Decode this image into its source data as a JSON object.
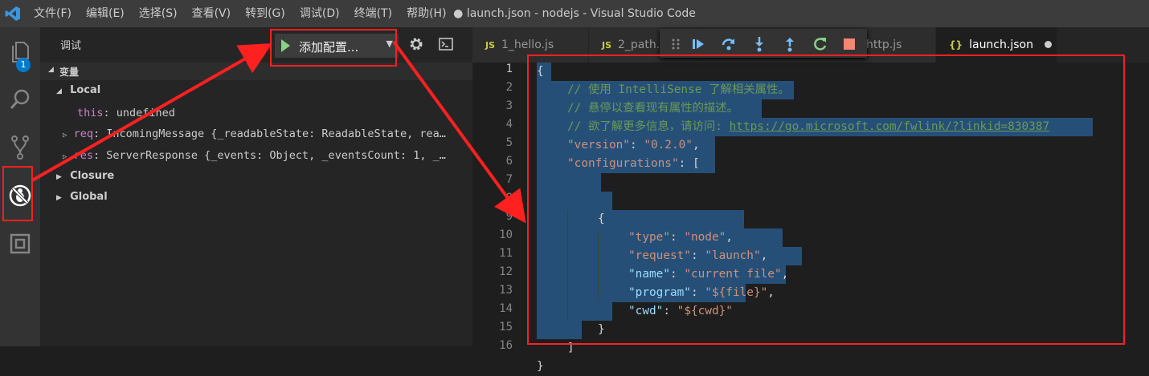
{
  "window": {
    "title": "● launch.json - nodejs - Visual Studio Code"
  },
  "menu": [
    "文件(F)",
    "编辑(E)",
    "选择(S)",
    "查看(V)",
    "转到(G)",
    "调试(D)",
    "终端(T)",
    "帮助(H)"
  ],
  "activity": {
    "badge": "1"
  },
  "sidebar": {
    "title": "调试",
    "config_label": "添加配置...",
    "sections": {
      "variables": "变量",
      "local": "Local",
      "closure": "Closure",
      "global": "Global"
    },
    "vars": {
      "this": {
        "name": "this",
        "value": "undefined"
      },
      "req": {
        "name": "req",
        "value": "IncomingMessage {_readableState: ReadableState, rea…"
      },
      "res": {
        "name": "res",
        "value": "ServerResponse {_events: Object, _eventsCount: 1, _…"
      }
    }
  },
  "tabs": [
    {
      "icon": "JS",
      "label": "1_hello.js"
    },
    {
      "icon": "JS",
      "label": "2_path.js"
    },
    {
      "icon": "JS",
      "label": "http.js"
    },
    {
      "icon": "{}",
      "label": "launch.json",
      "active": true
    }
  ],
  "editor": {
    "line_numbers": [
      "1",
      "2",
      "3",
      "4",
      "5",
      "6",
      "7",
      "8",
      "9",
      "10",
      "11",
      "12",
      "13",
      "14",
      "15",
      "16"
    ],
    "l1": "{",
    "l2": "// 使用 IntelliSense 了解相关属性。",
    "l3": "// 悬停以查看现有属性的描述。",
    "l4_comment": "// 欲了解更多信息，请访问: ",
    "l4_link": "https://go.microsoft.com/fwlink/?linkid=830387",
    "version_key": "\"version\"",
    "version_val": "\"0.2.0\"",
    "configs_key": "\"configurations\"",
    "l9": "{",
    "type_key": "\"type\"",
    "type_val": "\"node\"",
    "request_key": "\"request\"",
    "request_val": "\"launch\"",
    "name_key": "\"name\"",
    "name_val": "\"current file\"",
    "program_key": "\"program\"",
    "program_val": "\"${file}\"",
    "cwd_key": "\"cwd\"",
    "cwd_val": "\"${cwd}\"",
    "l14": "}",
    "l15": "]",
    "l16": "}"
  },
  "colors": {
    "annotation": "#ff2020",
    "selection": "#264f78",
    "accent": "#007acc"
  }
}
